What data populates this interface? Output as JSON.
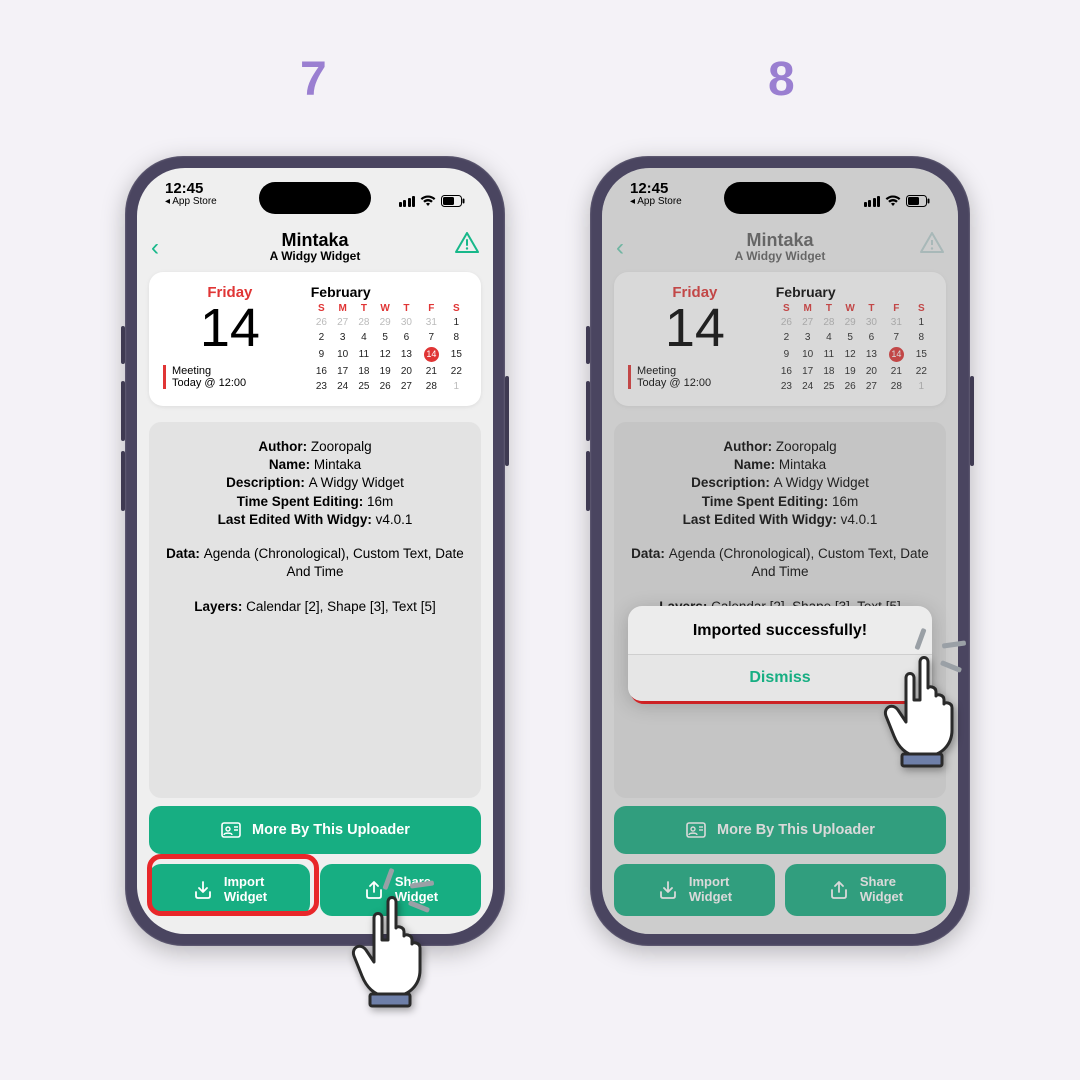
{
  "steps": {
    "left": "7",
    "right": "8"
  },
  "status": {
    "time": "12:45",
    "back_app": "◂ App Store"
  },
  "nav": {
    "title": "Mintaka",
    "subtitle": "A Widgy Widget"
  },
  "widget": {
    "day_name": "Friday",
    "day_num": "14",
    "event1": "Meeting",
    "event2": "Today @ 12:00",
    "month": "February",
    "dow": [
      "S",
      "M",
      "T",
      "W",
      "T",
      "F",
      "S"
    ],
    "rows": [
      [
        {
          "v": "26",
          "d": 1
        },
        {
          "v": "27",
          "d": 1
        },
        {
          "v": "28",
          "d": 1
        },
        {
          "v": "29",
          "d": 1
        },
        {
          "v": "30",
          "d": 1
        },
        {
          "v": "31",
          "d": 1
        },
        {
          "v": "1"
        }
      ],
      [
        {
          "v": "2"
        },
        {
          "v": "3"
        },
        {
          "v": "4"
        },
        {
          "v": "5"
        },
        {
          "v": "6"
        },
        {
          "v": "7"
        },
        {
          "v": "8"
        }
      ],
      [
        {
          "v": "9"
        },
        {
          "v": "10"
        },
        {
          "v": "11"
        },
        {
          "v": "12"
        },
        {
          "v": "13"
        },
        {
          "v": "14",
          "t": 1
        },
        {
          "v": "15"
        }
      ],
      [
        {
          "v": "16"
        },
        {
          "v": "17"
        },
        {
          "v": "18"
        },
        {
          "v": "19"
        },
        {
          "v": "20"
        },
        {
          "v": "21"
        },
        {
          "v": "22"
        }
      ],
      [
        {
          "v": "23"
        },
        {
          "v": "24"
        },
        {
          "v": "25"
        },
        {
          "v": "26"
        },
        {
          "v": "27"
        },
        {
          "v": "28"
        },
        {
          "v": "1",
          "d": 1
        }
      ]
    ]
  },
  "meta": {
    "author_l": "Author: ",
    "author_v": "Zooropalg",
    "name_l": "Name: ",
    "name_v": "Mintaka",
    "desc_l": "Description: ",
    "desc_v": "A Widgy Widget",
    "time_l": "Time Spent Editing: ",
    "time_v": "16m",
    "last_l": "Last Edited With Widgy: ",
    "last_v": "v4.0.1",
    "data_l": "Data: ",
    "data_v": "Agenda (Chronological), Custom Text, Date And Time",
    "layers_l": "Layers: ",
    "layers_v": "Calendar [2], Shape [3], Text [5]"
  },
  "buttons": {
    "more": "More By This Uploader",
    "import1": "Import",
    "import2": "Widget",
    "share1": "Share",
    "share2": "Widget"
  },
  "alert": {
    "title": "Imported successfully!",
    "dismiss": "Dismiss"
  }
}
